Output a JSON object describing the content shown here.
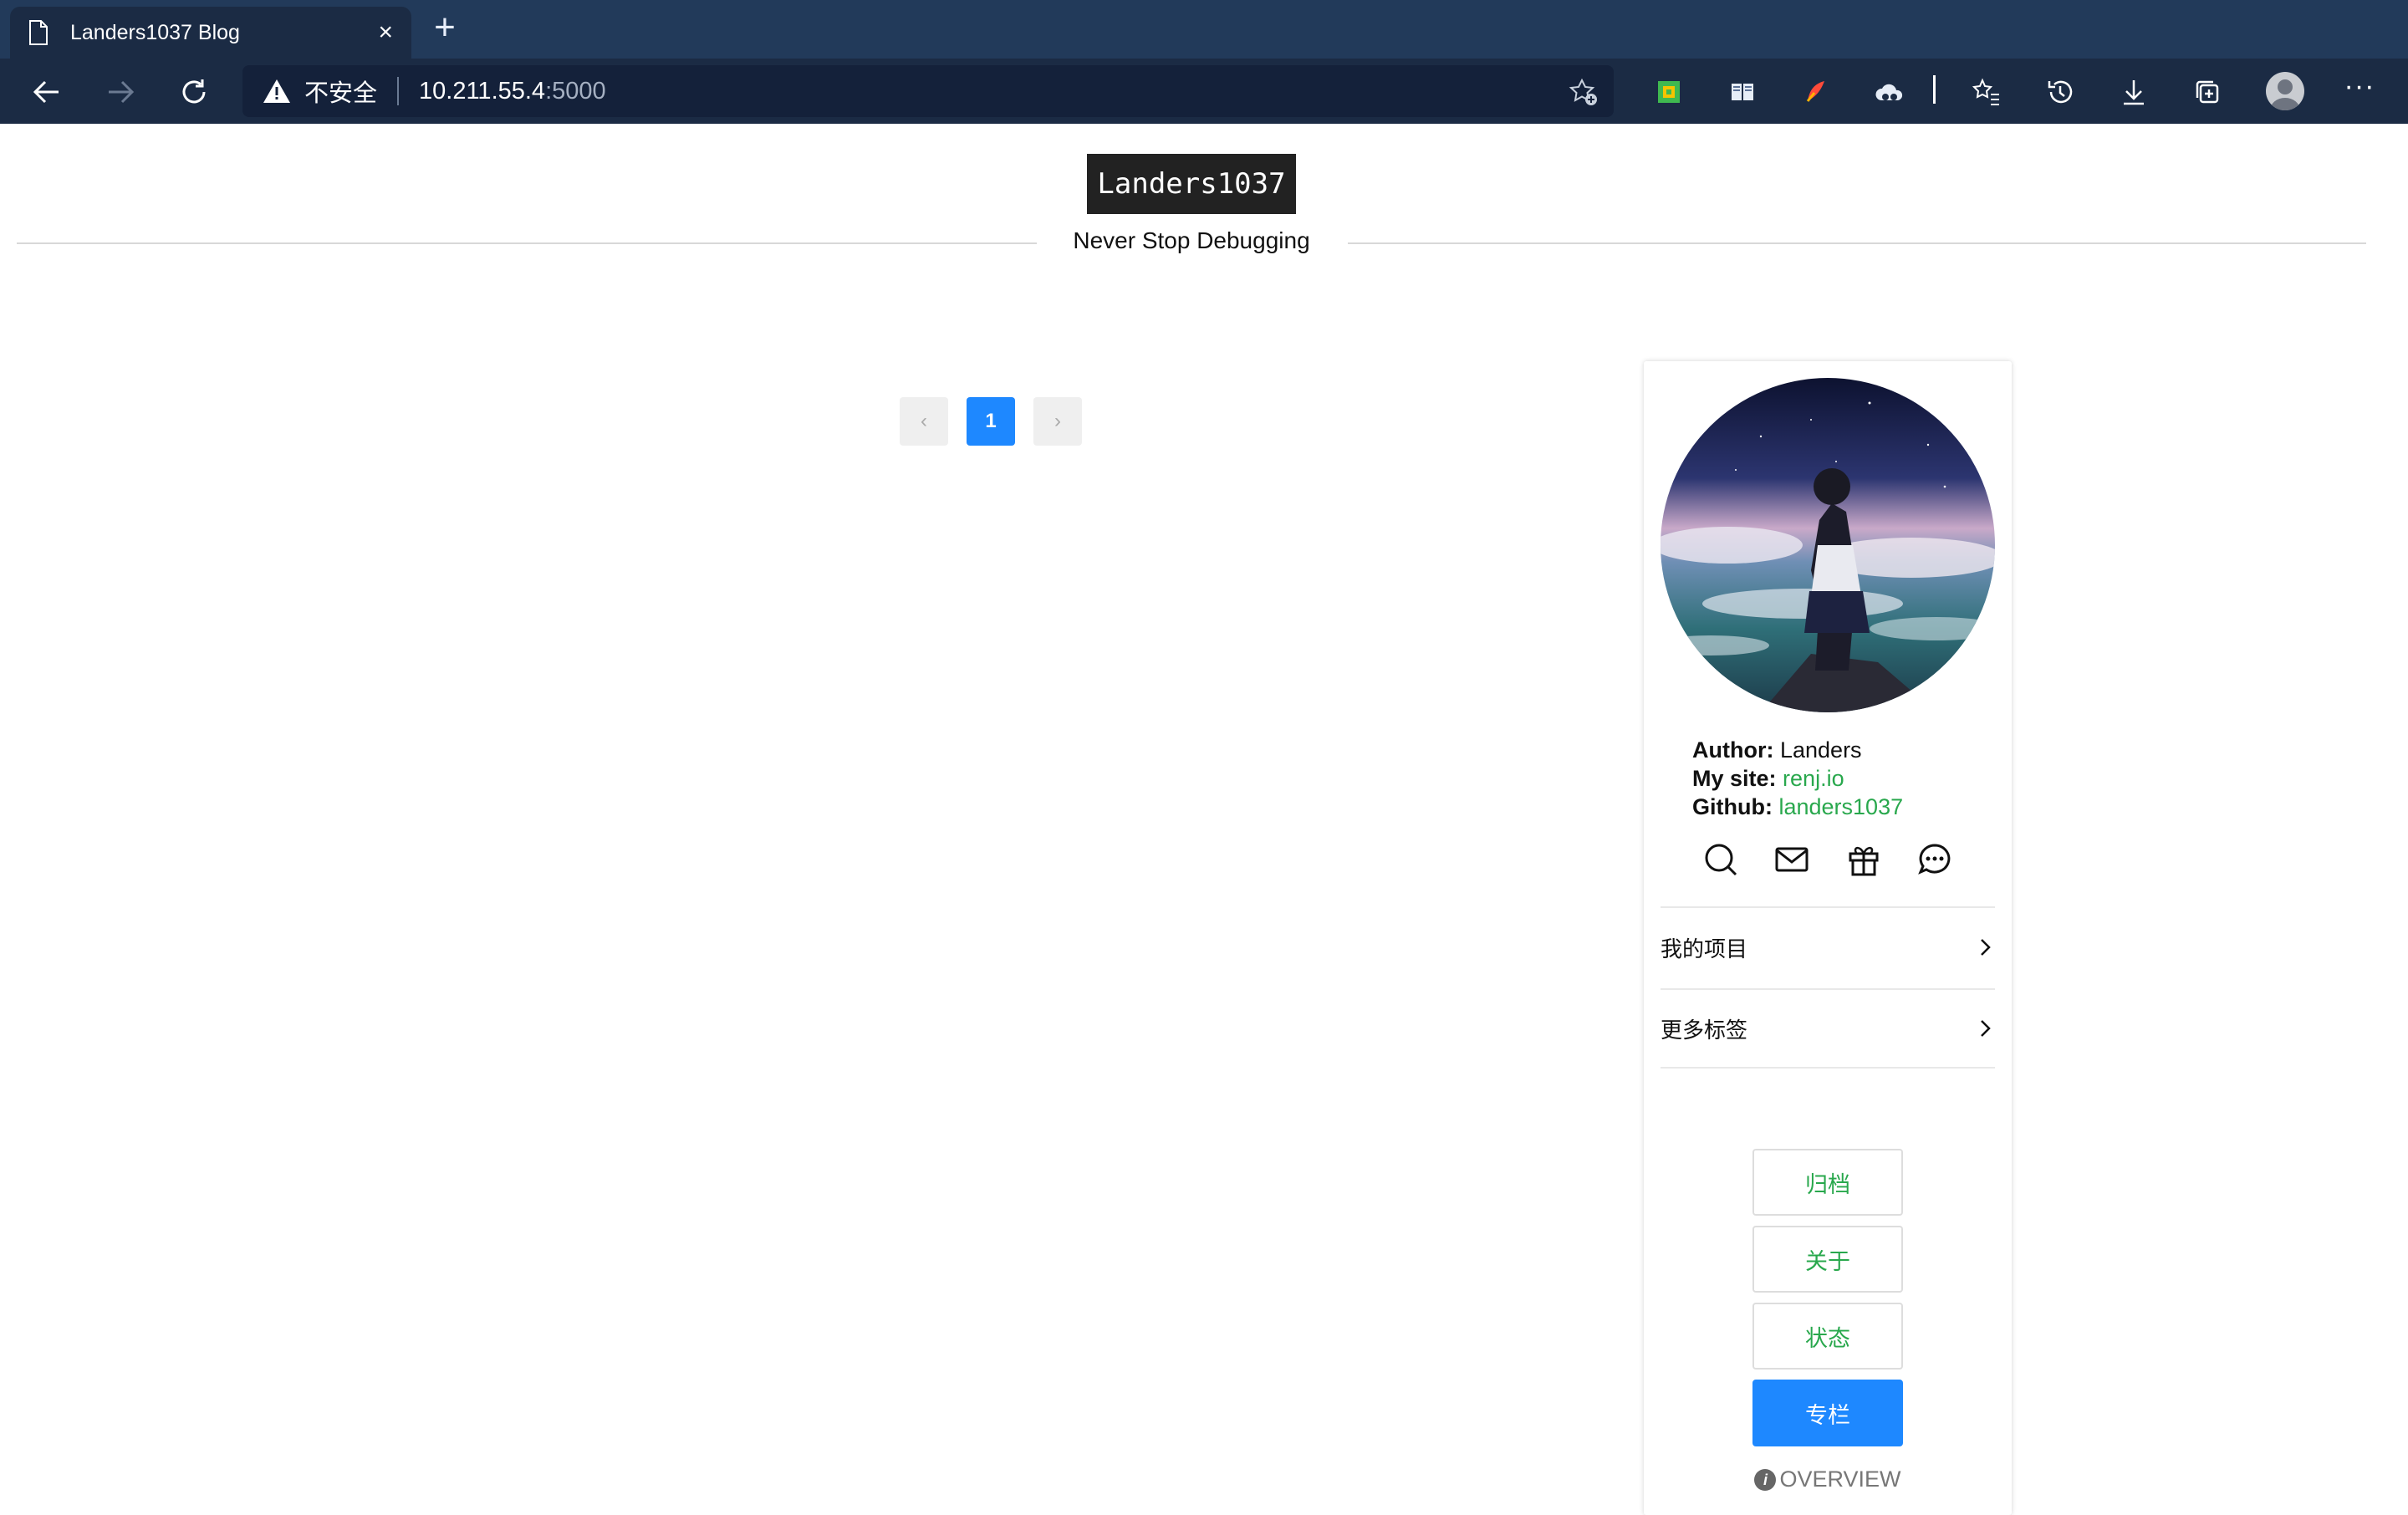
{
  "browser": {
    "tab_title": "Landers1037 Blog",
    "tab_close": "×",
    "new_tab": "+",
    "address": {
      "security_label": "不安全",
      "host": "10.211.55.4",
      "port": ":5000"
    },
    "more_label": "···",
    "icons": {
      "back": "back-arrow-icon",
      "forward": "forward-arrow-icon",
      "reload": "reload-icon",
      "favorite_add": "star-add-icon",
      "extensions": [
        "extension-green-icon",
        "extension-book-icon",
        "extension-feather-icon",
        "extension-cloud-icon"
      ],
      "favorites": "favorites-list-icon",
      "history": "history-icon",
      "downloads": "download-icon",
      "collections": "collections-icon"
    }
  },
  "header": {
    "site_title": "Landers1037",
    "subtitle": "Never Stop Debugging"
  },
  "pagination": {
    "prev": "‹",
    "current": "1",
    "next": "›"
  },
  "sidebar": {
    "author_label": "Author:",
    "author_value": "Landers",
    "site_label": "My site:",
    "site_value": "renj.io",
    "github_label": "Github:",
    "github_value": "landers1037",
    "social_icons": [
      "search-icon",
      "mail-icon",
      "gift-icon",
      "chat-icon"
    ],
    "menu": [
      {
        "label": "我的项目"
      },
      {
        "label": "更多标签"
      }
    ],
    "links": [
      {
        "label": "归档"
      },
      {
        "label": "关于"
      },
      {
        "label": "状态"
      },
      {
        "label": "专栏"
      }
    ],
    "overview_label": "OVERVIEW",
    "overview_icon": "i"
  },
  "colors": {
    "chrome_tabbar": "#223a5a",
    "chrome_toolbar": "#1b2b44",
    "accent_blue": "#1e88ff",
    "link_green": "#29a84d"
  }
}
